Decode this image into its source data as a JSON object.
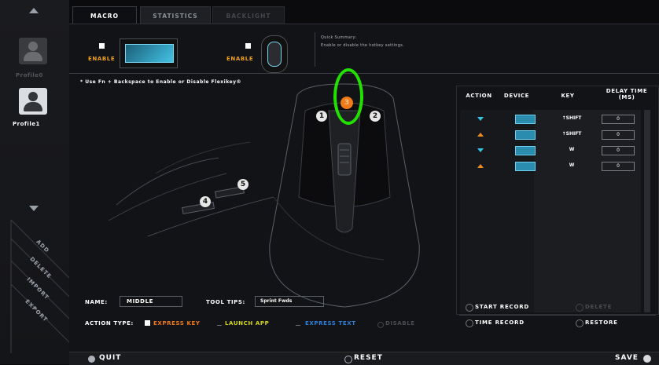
{
  "sidebar": {
    "profile_disabled_label": "Profile0",
    "profile_active_label": "Profile1",
    "tabs": [
      "ADD",
      "DELETE",
      "IMPORT",
      "EXPORT"
    ]
  },
  "tabs": [
    {
      "label": "MACRO",
      "active": true
    },
    {
      "label": "STATISTICS",
      "active": false
    },
    {
      "label": "BACKLIGHT",
      "active": false
    }
  ],
  "enable_keyboard": {
    "label": "ENABLE"
  },
  "enable_mouse": {
    "label": "ENABLE"
  },
  "quick_summary": {
    "title": "Quick Summary:",
    "text": "Enable or disable the hotkey settings."
  },
  "hint": "* Use Fn + Backspace to Enable or Disable Flexikey®",
  "buttons_map": [
    "1",
    "2",
    "3",
    "4",
    "5"
  ],
  "table": {
    "headers": [
      "ACTION",
      "DEVICE",
      "KEY",
      "DELAY TIME (MS)"
    ],
    "rows": [
      {
        "action": "down",
        "key": "↑SHIFT",
        "delay": "0"
      },
      {
        "action": "up",
        "key": "↑SHIFT",
        "delay": "0"
      },
      {
        "action": "down",
        "key": "W",
        "delay": "0"
      },
      {
        "action": "up",
        "key": "W",
        "delay": "0"
      }
    ]
  },
  "name_field": {
    "label": "NAME:",
    "value": "MIDDLE"
  },
  "tooltips_field": {
    "label": "TOOL TIPS:",
    "value": "Sprint Fwds"
  },
  "action_type": {
    "label": "ACTION TYPE:",
    "options": [
      "EXPRESS KEY",
      "LAUNCH APP",
      "EXPRESS TEXT",
      "DISABLE"
    ]
  },
  "record_buttons": {
    "start_record": "START RECORD",
    "delete": "DELETE",
    "time_record": "TIME RECORD",
    "restore": "RESTORE"
  },
  "bottom": {
    "quit": "QUIT",
    "reset": "RESET",
    "save": "SAVE"
  },
  "colors": {
    "accent_orange": "#f0a020",
    "accent_blue": "#36c5e8",
    "highlight_green": "#22e000"
  }
}
